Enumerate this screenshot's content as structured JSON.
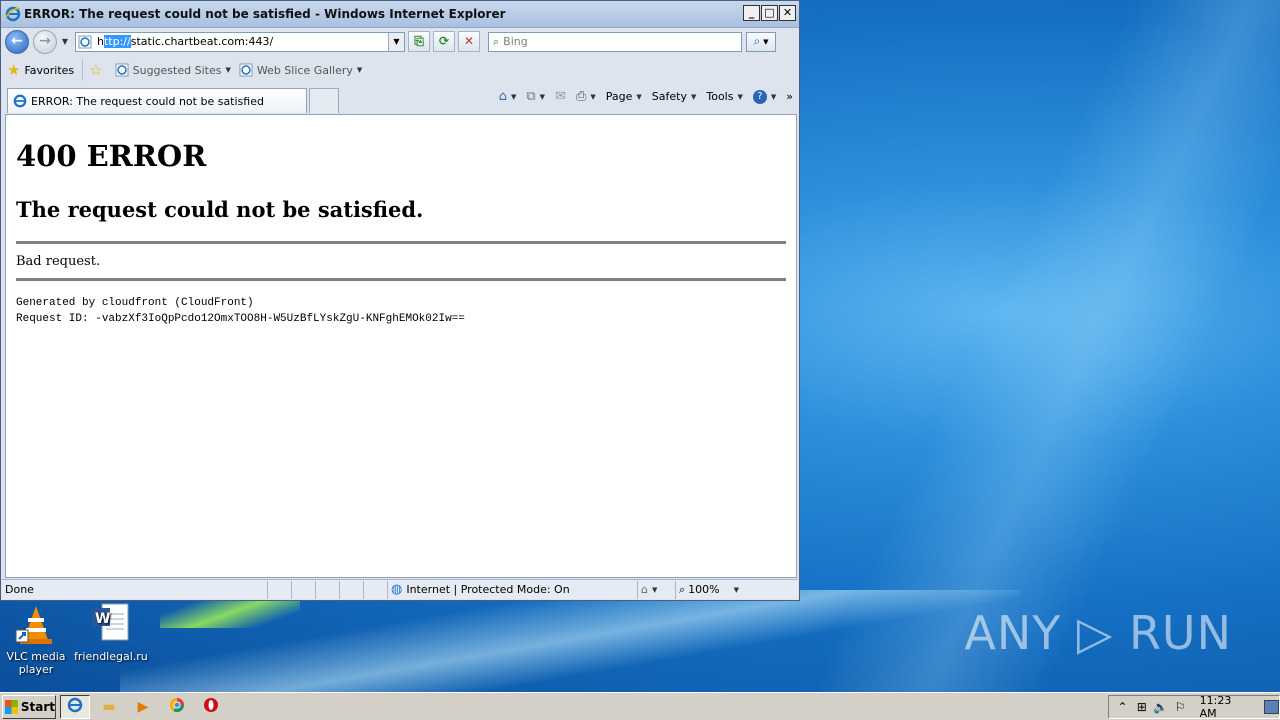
{
  "window": {
    "title": "ERROR: The request could not be satisfied - Windows Internet Explorer",
    "min_label": "_",
    "max_label": "□",
    "close_label": "✕"
  },
  "nav": {
    "back_label": "←",
    "forward_label": "→",
    "url_selected": "ttp://",
    "url_prefix": "h",
    "url_rest": "static.chartbeat.com:443/",
    "search_placeholder": "Bing"
  },
  "favorites": {
    "favorites_label": "Favorites",
    "items": [
      {
        "label": "Suggested Sites"
      },
      {
        "label": "Web Slice Gallery"
      }
    ]
  },
  "tab": {
    "label": "ERROR: The request could not be satisfied"
  },
  "commands": {
    "page": "Page",
    "safety": "Safety",
    "tools": "Tools",
    "more": "»"
  },
  "page": {
    "heading": "400 ERROR",
    "subheading": "The request could not be satisfied.",
    "message": "Bad request.",
    "generated": "Generated by cloudfront (CloudFront)",
    "request_id": "Request ID: -vabzXf3IoQpPcdo12OmxTOO8H-W5UzBfLYskZgU-KNFghEMOk02Iw=="
  },
  "status": {
    "left": "Done",
    "zone": "Internet | Protected Mode: On",
    "zoom": "100%"
  },
  "desktop": {
    "icons": [
      {
        "label": "VLC media player"
      },
      {
        "label": "friendlegal.ru"
      }
    ],
    "watermark": "ANY ▷ RUN"
  },
  "taskbar": {
    "start_label": "Start",
    "clock": "11:23 AM"
  }
}
